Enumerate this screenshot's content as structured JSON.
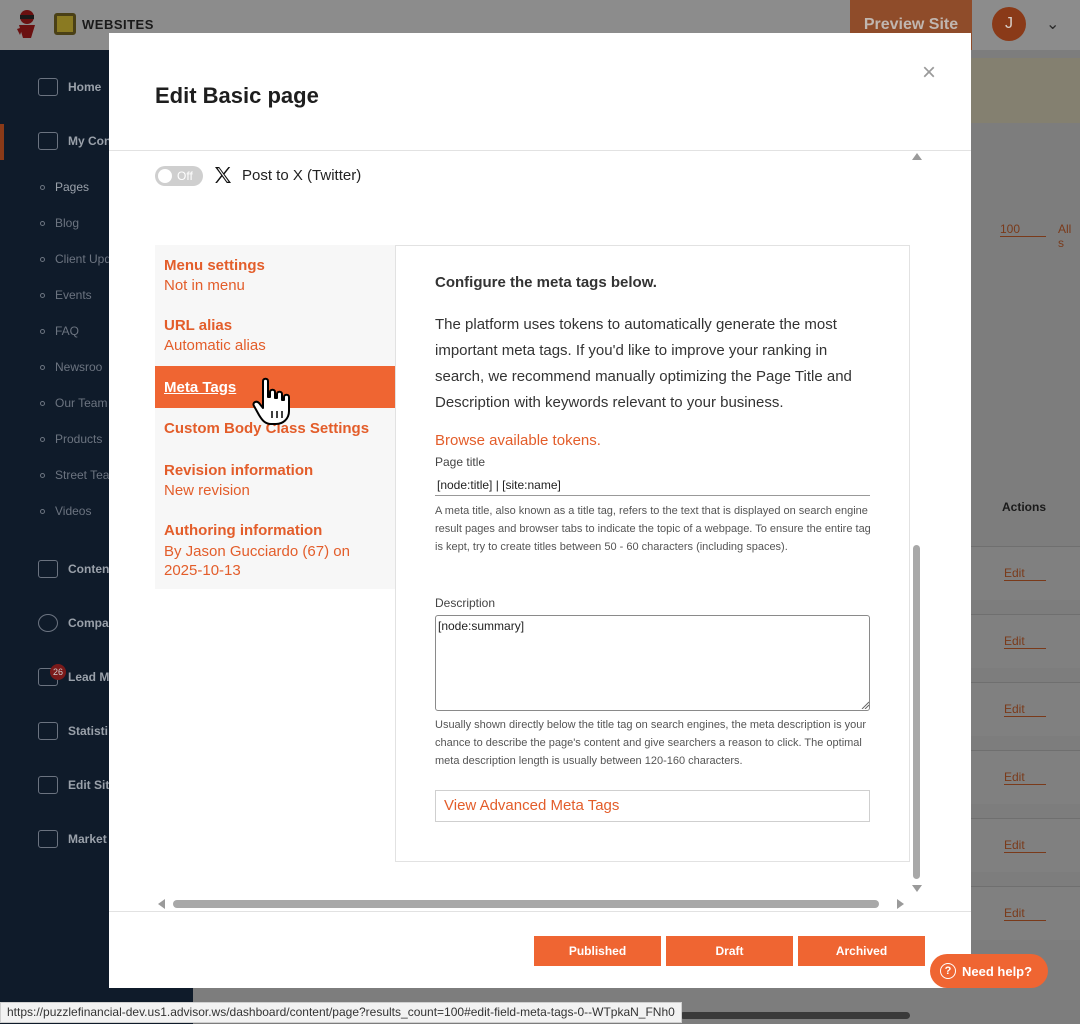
{
  "app": {
    "brand": "WEBSITES",
    "preview_label": "Preview Site",
    "avatar_initial": "J"
  },
  "sidebar": {
    "main_items": [
      {
        "label": "Home"
      },
      {
        "label": "My Con"
      },
      {
        "label": "Content"
      },
      {
        "label": "Compa"
      },
      {
        "label": "Lead Ma"
      },
      {
        "label": "Statisti"
      },
      {
        "label": "Edit Site"
      },
      {
        "label": "Market"
      }
    ],
    "sub_items": [
      {
        "label": "Pages"
      },
      {
        "label": "Blog"
      },
      {
        "label": "Client Upd"
      },
      {
        "label": "Events"
      },
      {
        "label": "FAQ"
      },
      {
        "label": "Newsroo"
      },
      {
        "label": "Our Team"
      },
      {
        "label": "Products"
      },
      {
        "label": "Street Tea"
      },
      {
        "label": "Videos"
      }
    ],
    "lead_badge": "26"
  },
  "background": {
    "page_count_select": "100",
    "all_select": "All s",
    "actions_header": "Actions",
    "row_edit_label": "Edit"
  },
  "modal": {
    "title": "Edit Basic page",
    "close_symbol": "×",
    "toggle_state": "Off",
    "post_x_label": "Post to X (Twitter)",
    "tabs": [
      {
        "title": "Menu settings",
        "summary": "Not in menu"
      },
      {
        "title": "URL alias",
        "summary": "Automatic alias"
      },
      {
        "title": "Meta Tags",
        "summary": ""
      },
      {
        "title": "Custom Body Class Settings",
        "summary": ""
      },
      {
        "title": "Revision information",
        "summary": "New revision"
      },
      {
        "title": "Authoring information",
        "summary": "By Jason Gucciardo (67) on 2025-10-13"
      }
    ],
    "active_tab": "Meta Tags",
    "panel": {
      "heading": "Configure the meta tags below.",
      "description": "The platform uses tokens to automatically generate the most important meta tags. If you'd like to improve your ranking in search, we recommend manually optimizing the Page Title and Description with keywords relevant to your business.",
      "browse_tokens": "Browse available tokens.",
      "page_title_label": "Page title",
      "page_title_value": "[node:title] | [site:name]",
      "page_title_help": "A meta title, also known as a title tag, refers to the text that is displayed on search engine result pages and browser tabs to indicate the topic of a webpage. To ensure the entire tag is kept, try to create titles between 50 - 60 characters (including spaces).",
      "description_label": "Description",
      "description_value": "[node:summary]",
      "description_help": "Usually shown directly below the title tag on search engines, the meta description is your chance to describe the page's content and give searchers a reason to click. The optimal meta description length is usually between 120-160 characters.",
      "advanced_label": "View Advanced Meta Tags"
    },
    "buttons": {
      "published": "Published",
      "draft": "Draft",
      "archived": "Archived"
    }
  },
  "need_help": "Need help?",
  "status_url": "https://puzzlefinancial-dev.us1.advisor.ws/dashboard/content/page?results_count=100#edit-field-meta-tags-0--WTpkaN_FNh0",
  "colors": {
    "accent": "#ef6532",
    "accent_text": "#e35d2a",
    "sidebar_bg": "#0f1b2a"
  }
}
